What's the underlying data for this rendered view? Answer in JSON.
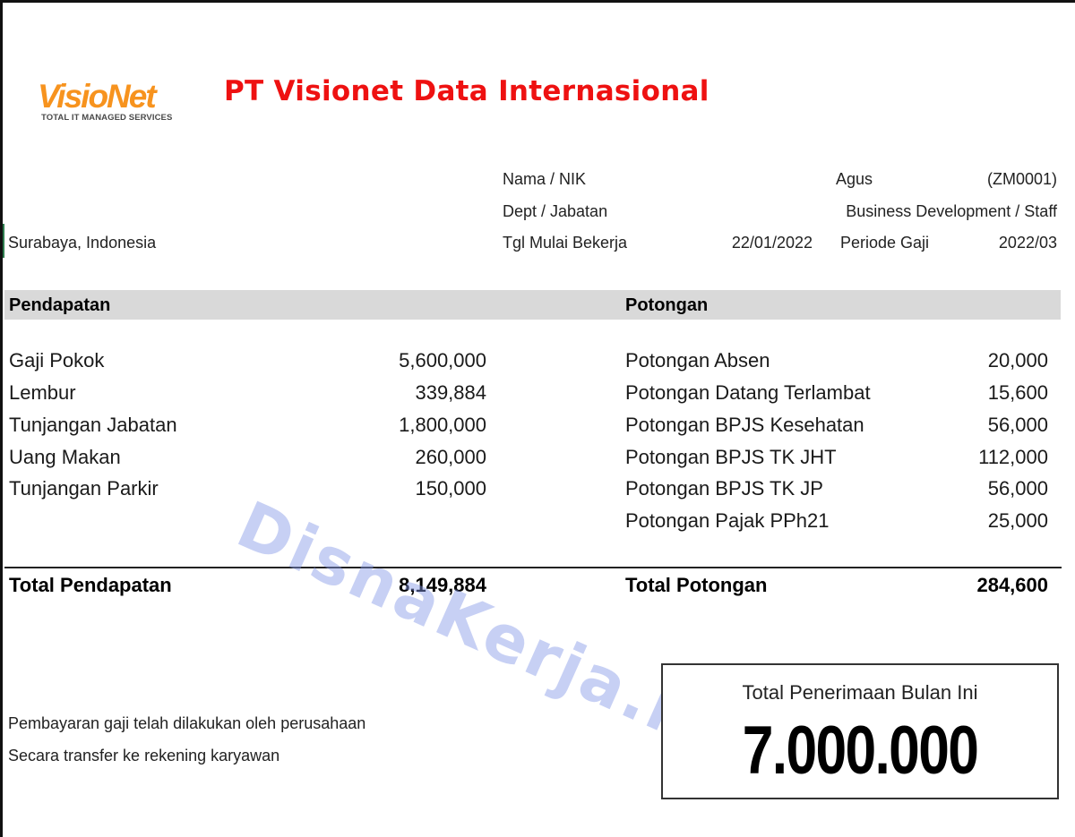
{
  "header": {
    "logo_word": "VisioNet",
    "logo_tagline": "TOTAL IT MANAGED SERVICES",
    "company_name": "PT Visionet Data Internasional",
    "location": "Surabaya, Indonesia",
    "colors": {
      "company_name": "#ee1111",
      "logo": "#f7931e"
    }
  },
  "employee": {
    "name_label": "Nama / NIK",
    "name": "Agus",
    "nik": "(ZM0001)",
    "dept_label": "Dept / Jabatan",
    "dept": "Business Development / Staff",
    "start_label": "Tgl Mulai Bekerja",
    "start_date": "22/01/2022",
    "period_label": "Periode Gaji",
    "period": "2022/03"
  },
  "income": {
    "title": "Pendapatan",
    "items": [
      {
        "label": "Gaji Pokok",
        "value": "5,600,000"
      },
      {
        "label": "Lembur",
        "value": "339,884"
      },
      {
        "label": "Tunjangan Jabatan",
        "value": "1,800,000"
      },
      {
        "label": "Uang Makan",
        "value": "260,000"
      },
      {
        "label": "Tunjangan Parkir",
        "value": "150,000"
      }
    ],
    "total_label": "Total Pendapatan",
    "total_value": "8,149,884"
  },
  "deductions": {
    "title": "Potongan",
    "items": [
      {
        "label": "Potongan Absen",
        "value": "20,000"
      },
      {
        "label": "Potongan Datang Terlambat",
        "value": "15,600"
      },
      {
        "label": "Potongan BPJS Kesehatan",
        "value": "56,000"
      },
      {
        "label": "Potongan BPJS TK JHT",
        "value": "112,000"
      },
      {
        "label": "Potongan BPJS TK JP",
        "value": "56,000"
      },
      {
        "label": "Potongan Pajak PPh21",
        "value": "25,000"
      }
    ],
    "total_label": "Total Potongan",
    "total_value": "284,600"
  },
  "notes": [
    "Pembayaran gaji telah dilakukan oleh perusahaan",
    "Secara transfer ke rekening karyawan"
  ],
  "net_pay": {
    "label": "Total Penerimaan Bulan Ini",
    "value": "7.000.000"
  },
  "watermark": "DisnaKerja.id"
}
